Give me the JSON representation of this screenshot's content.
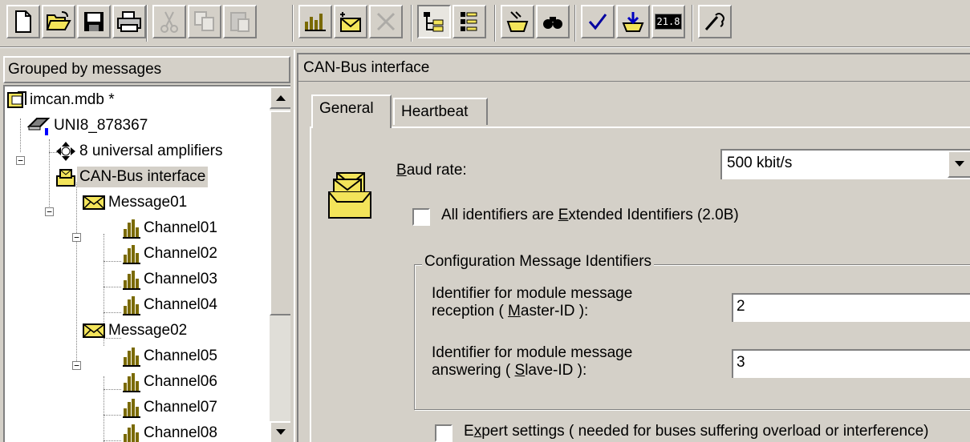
{
  "toolbar": {
    "buttons": [
      {
        "name": "new-file-icon"
      },
      {
        "name": "open-folder-icon"
      },
      {
        "name": "save-disk-icon"
      },
      {
        "name": "print-icon"
      },
      {
        "name": "cut-icon"
      },
      {
        "name": "copy-icon"
      },
      {
        "name": "paste-icon"
      },
      {
        "name": "add-channel-icon"
      },
      {
        "name": "add-message-icon"
      },
      {
        "name": "delete-icon"
      },
      {
        "name": "tree-view-icon"
      },
      {
        "name": "list-view-icon"
      },
      {
        "name": "import-icon"
      },
      {
        "name": "find-icon"
      },
      {
        "name": "check-icon"
      },
      {
        "name": "download-icon"
      },
      {
        "name": "value-display-icon",
        "text": "21.8"
      },
      {
        "name": "wizard-icon"
      }
    ]
  },
  "tree": {
    "header": "Grouped by messages",
    "items": [
      {
        "label": "imcan.mdb *",
        "icon": "database-icon",
        "level": 0
      },
      {
        "label": "UNI8_878367",
        "icon": "network-device-icon",
        "level": 1
      },
      {
        "label": "8 universal amplifiers",
        "icon": "amplifier-icon",
        "level": 2
      },
      {
        "label": "CAN-Bus interface",
        "icon": "can-bus-icon",
        "level": 2,
        "selected": true
      },
      {
        "label": "Message01",
        "icon": "envelope-icon",
        "level": 3
      },
      {
        "label": "Channel01",
        "icon": "channel-icon",
        "level": 4
      },
      {
        "label": "Channel02",
        "icon": "channel-icon",
        "level": 4
      },
      {
        "label": "Channel03",
        "icon": "channel-icon",
        "level": 4
      },
      {
        "label": "Channel04",
        "icon": "channel-icon",
        "level": 4
      },
      {
        "label": "Message02",
        "icon": "envelope-icon",
        "level": 3
      },
      {
        "label": "Channel05",
        "icon": "channel-icon",
        "level": 4
      },
      {
        "label": "Channel06",
        "icon": "channel-icon",
        "level": 4
      },
      {
        "label": "Channel07",
        "icon": "channel-icon",
        "level": 4
      },
      {
        "label": "Channel08",
        "icon": "channel-icon",
        "level": 4
      }
    ]
  },
  "panel": {
    "title": "CAN-Bus interface",
    "tabs": [
      {
        "label": "General",
        "active": true
      },
      {
        "label": "Heartbeat",
        "active": false
      }
    ],
    "baud": {
      "label_pre": "",
      "label_key": "B",
      "label_post": "aud rate:",
      "value": "500 kbit/s"
    },
    "extended": {
      "label_pre": "All identifiers are ",
      "label_key": "E",
      "label_post": "xtended Identifiers (2.0B)",
      "checked": false
    },
    "group": {
      "legend": "Configuration Message Identifiers",
      "master": {
        "line1": "Identifier for module message",
        "line2_pre": "reception ( ",
        "line2_key": "M",
        "line2_post": "aster-ID ):",
        "value": "2"
      },
      "slave": {
        "line1": "Identifier for module message",
        "line2_pre": "answering ( ",
        "line2_key": "S",
        "line2_post": "lave-ID ):",
        "value": "3"
      }
    },
    "expert": {
      "label_pre": "E",
      "label_key": "x",
      "label_post": "pert settings ( needed for buses suffering overload or interference)",
      "checked": false
    }
  },
  "colors": {
    "face": "#d4d0c8",
    "icon_yellow": "#f3e45a",
    "selection": "#d4d0c8"
  }
}
